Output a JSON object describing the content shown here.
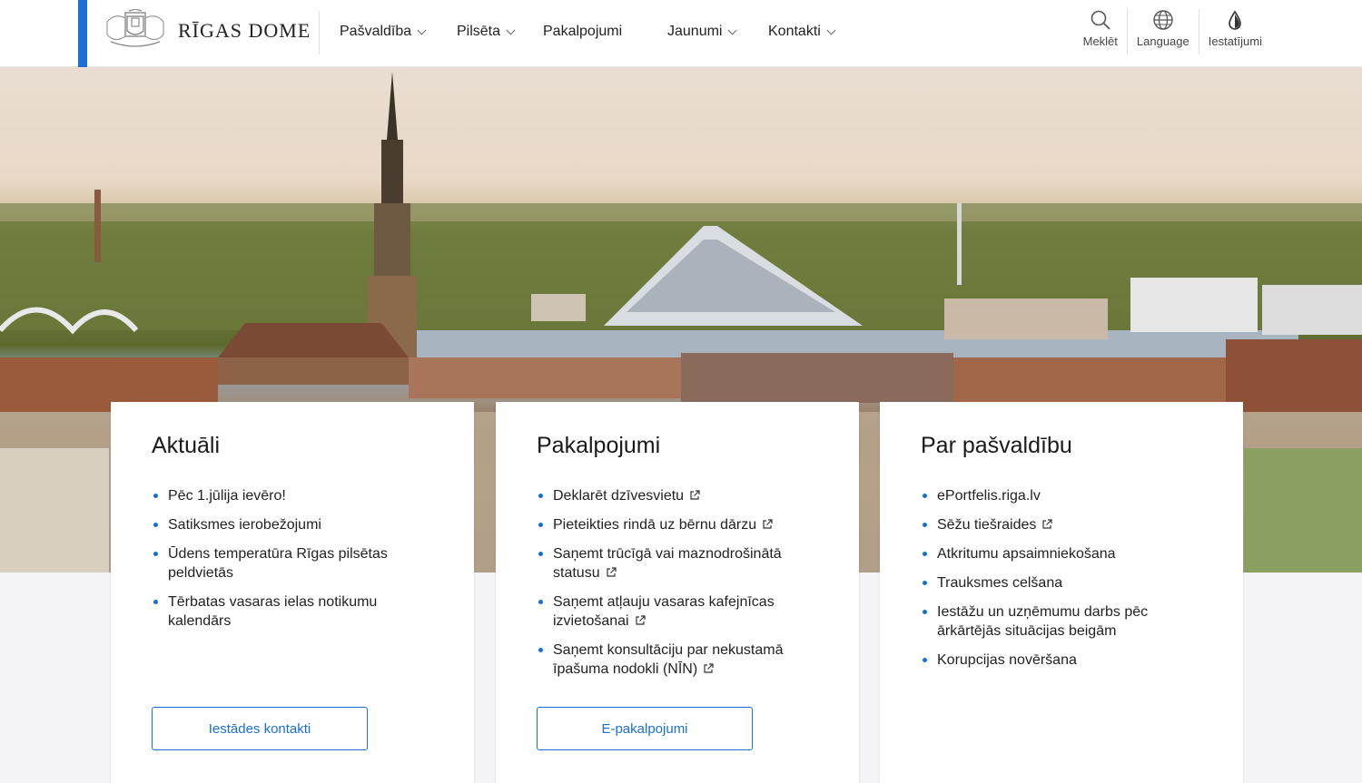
{
  "header": {
    "logo_text": "RĪGAS DOME",
    "nav": [
      {
        "label": "Pašvaldība",
        "has_dropdown": true
      },
      {
        "label": "Pilsēta",
        "has_dropdown": true
      },
      {
        "label": "Pakalpojumi",
        "has_dropdown": false
      },
      {
        "label": "Jaunumi",
        "has_dropdown": true
      },
      {
        "label": "Kontakti",
        "has_dropdown": true
      }
    ],
    "tools": [
      {
        "label": "Meklēt",
        "icon": "search-icon"
      },
      {
        "label": "Language",
        "icon": "globe-icon"
      },
      {
        "label": "Iestatījumi",
        "icon": "drop-icon"
      }
    ],
    "accent_color": "#1a6ed8"
  },
  "cards": [
    {
      "title": "Aktuāli",
      "items": [
        {
          "text": "Pēc 1.jūlija ievēro!",
          "external": false
        },
        {
          "text": "Satiksmes ierobežojumi",
          "external": false
        },
        {
          "text": "Ūdens temperatūra Rīgas pilsētas peldvietās",
          "external": false
        },
        {
          "text": "Tērbatas vasaras ielas notikumu kalendārs",
          "external": false
        }
      ],
      "button": "Iestādes kontakti"
    },
    {
      "title": "Pakalpojumi",
      "items": [
        {
          "text": "Deklarēt dzīvesvietu",
          "external": true
        },
        {
          "text": "Pieteikties rindā uz bērnu dārzu",
          "external": true
        },
        {
          "text": "Saņemt trūcīgā vai maznodrošinātā statusu",
          "external": true
        },
        {
          "text": "Saņemt atļauju vasaras kafejnīcas izvietošanai",
          "external": true
        },
        {
          "text": "Saņemt konsultāciju par nekustamā īpašuma nodokli (NĪN)",
          "external": true
        }
      ],
      "button": "E-pakalpojumi"
    },
    {
      "title": "Par pašvaldību",
      "items": [
        {
          "text": "ePortfelis.riga.lv",
          "external": false
        },
        {
          "text": "Sēžu tiešraides",
          "external": true
        },
        {
          "text": "Atkritumu apsaimniekošana",
          "external": false
        },
        {
          "text": "Trauksmes celšana",
          "external": false
        },
        {
          "text": "Iestāžu un uzņēmumu darbs pēc ārkārtējās situācijas beigām",
          "external": false
        },
        {
          "text": "Korupcijas novēršana",
          "external": false
        }
      ],
      "button": ""
    }
  ]
}
